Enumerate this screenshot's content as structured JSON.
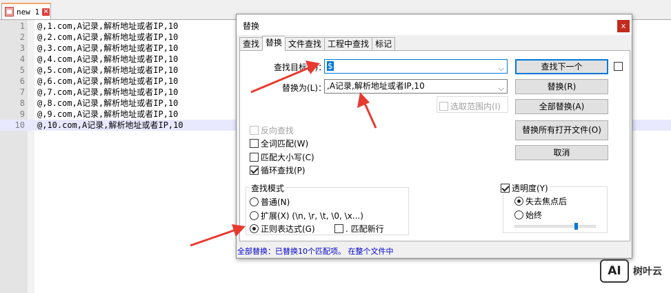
{
  "editor": {
    "tab_label": "new 1",
    "tab_close": "×",
    "line_numbers": [
      "1",
      "2",
      "3",
      "4",
      "5",
      "6",
      "7",
      "8",
      "9",
      "10"
    ],
    "lines": [
      "@,1.com,A记录,解析地址或者IP,10",
      "@,2.com,A记录,解析地址或者IP,10",
      "@,3.com,A记录,解析地址或者IP,10",
      "@,4.com,A记录,解析地址或者IP,10",
      "@,5.com,A记录,解析地址或者IP,10",
      "@,6.com,A记录,解析地址或者IP,10",
      "@,7.com,A记录,解析地址或者IP,10",
      "@,8.com,A记录,解析地址或者IP,10",
      "@,9.com,A记录,解析地址或者IP,10",
      "@,10.com,A记录,解析地址或者IP,10"
    ]
  },
  "dialog": {
    "title": "替换",
    "close": "x",
    "tabs": [
      "查找",
      "替换",
      "文件查找",
      "工程中查找",
      "标记"
    ],
    "find_label": "查找目标(F)：",
    "find_value": "$",
    "replace_label": "替换为(L)：",
    "replace_value": ",A记录,解析地址或者IP,10",
    "dropdown_glyph": "⌵",
    "in_selection": "选取范围内(I)",
    "buttons": {
      "find_next": "查找下一个",
      "replace": "替换(R)",
      "replace_all": "全部替换(A)",
      "replace_all_open": "替换所有打开文件(O)",
      "cancel": "取消"
    },
    "options": {
      "backward": "反向查找",
      "whole_word": "全词匹配(W)",
      "match_case": "匹配大小写(C)",
      "wrap_around": "循环查找(P)"
    },
    "search_mode": {
      "title": "查找模式",
      "normal": "普通(N)",
      "extended": "扩展(X) (\\n, \\r, \\t, \\0, \\x...)",
      "regex": "正则表达式(G)",
      "dot_newline": ". 匹配新行"
    },
    "transparency": {
      "title": "透明度(Y)",
      "on_lose_focus": "失去焦点后",
      "always": "始终",
      "level": 0.75
    },
    "status": "全部替换：已替换10个匹配项。 在整个文件中"
  },
  "watermark": {
    "logo_text": "AI",
    "brand": "树叶云"
  },
  "colors": {
    "arrow": "#e8392f",
    "accent": "#0078d7",
    "status_text": "#0000cc"
  }
}
